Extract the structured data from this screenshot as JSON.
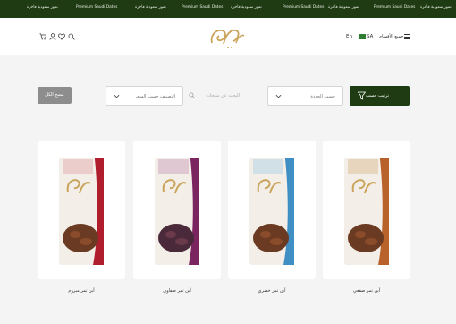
{
  "promo": {
    "messages": [
      "تمور سعودية فاخرة",
      "Premium Saudi Dates",
      "تمور سعودية فاخرة",
      "Premium Saudi Dates",
      "تمور سعودية فاخرة",
      "Premium Saudi Dates",
      "تمور سعودية فاخرة",
      "Premium Saudi Dates",
      "تمور سعودية فاخرة"
    ]
  },
  "header": {
    "lang": "En",
    "country": "SA",
    "all_categories": "جميع الأقسام",
    "icons": [
      "cart-icon",
      "user-icon",
      "heart-icon",
      "search-icon",
      "menu-icon"
    ]
  },
  "toolbar": {
    "filter_label": "ترتيب حسب",
    "sort_by": "حسب الجودة",
    "sort_price": "التصنيف حسب السعر",
    "search_placeholder": "البحث عن منتجات",
    "clear_label": "مسح الكل"
  },
  "products": [
    {
      "name": "أبن تمر صقعي",
      "color": "#b8612b"
    },
    {
      "name": "أبن تمر خضري",
      "color": "#3f8fc4"
    },
    {
      "name": "أبن تمر صفاوي",
      "color": "#7b2560"
    },
    {
      "name": "أبن تمر مبروم",
      "color": "#b01e2e"
    }
  ],
  "colors": {
    "brand": "#1f3b13",
    "gold": "#c9a45a"
  }
}
